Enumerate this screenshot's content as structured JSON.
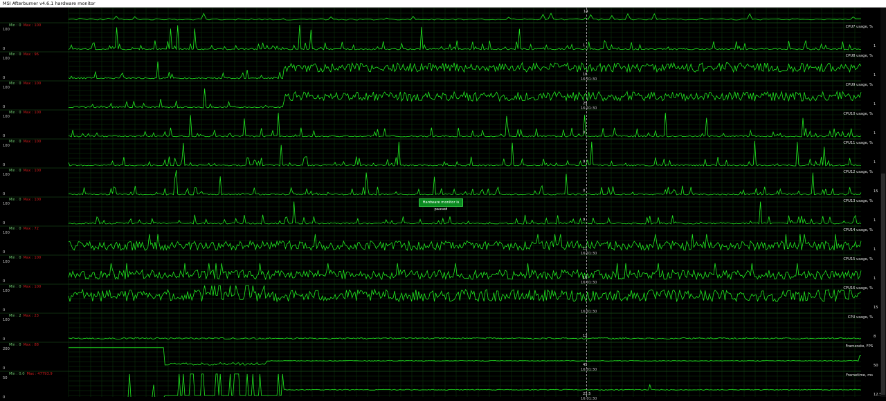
{
  "window": {
    "title": "MSI Afterburner v4.6.1 hardware monitor",
    "icon": "afterburner-icon"
  },
  "paused_message": "Hardware monitor is paused",
  "cursor_time": "16:01:30",
  "colors": {
    "background": "#000000",
    "grid": "#0f3d0f",
    "trace": "#22ee22",
    "min_text": "#6ec86e",
    "max_text": "#d21e1e",
    "banner": "#0a8a20"
  },
  "top_partial_graph": {
    "current_value": "14"
  },
  "graphs": [
    {
      "name": "CPU7 usage, %",
      "min": "Min : 0",
      "max": "Max : 100",
      "axis_top": "100",
      "axis_bottom": "0",
      "current_value": "1",
      "cursor_value": "1",
      "timestamp": ""
    },
    {
      "name": "CPU8 usage, %",
      "min": "Min : 0",
      "max": "Max : 96",
      "axis_top": "100",
      "axis_bottom": "0",
      "current_value": "1",
      "cursor_value": "16",
      "timestamp": "16:01:30"
    },
    {
      "name": "CPU9 usage, %",
      "min": "Min : 0",
      "max": "Max : 100",
      "axis_top": "100",
      "axis_bottom": "0",
      "current_value": "1",
      "cursor_value": "25",
      "timestamp": "16:01:30"
    },
    {
      "name": "CPU10 usage, %",
      "min": "Min : 0",
      "max": "Max : 100",
      "axis_top": "100",
      "axis_bottom": "0",
      "current_value": "1",
      "cursor_value": "0",
      "timestamp": ""
    },
    {
      "name": "CPU11 usage, %",
      "min": "Min : 0",
      "max": "Max : 100",
      "axis_top": "100",
      "axis_bottom": "0",
      "current_value": "1",
      "cursor_value": "9",
      "timestamp": ""
    },
    {
      "name": "CPU12 usage, %",
      "min": "Min : 0",
      "max": "Max : 100",
      "axis_top": "100",
      "axis_bottom": "0",
      "current_value": "15",
      "cursor_value": "0",
      "timestamp": ""
    },
    {
      "name": "CPU13 usage, %",
      "min": "Min : 0",
      "max": "Max : 100",
      "axis_top": "100",
      "axis_bottom": "0",
      "current_value": "1",
      "cursor_value": "9",
      "timestamp": ""
    },
    {
      "name": "CPU14 usage, %",
      "min": "Min : 0",
      "max": "Max : 72",
      "axis_top": "100",
      "axis_bottom": "0",
      "current_value": "1",
      "cursor_value": "12",
      "timestamp": "16:01:30"
    },
    {
      "name": "CPU15 usage, %",
      "min": "Min : 0",
      "max": "Max : 100",
      "axis_top": "100",
      "axis_bottom": "0",
      "current_value": "1",
      "cursor_value": "16",
      "timestamp": "16:01:30"
    },
    {
      "name": "CPU16 usage, %",
      "min": "Min : 0",
      "max": "Max : 100",
      "axis_top": "100",
      "axis_bottom": "0",
      "current_value": "15",
      "cursor_value": "",
      "timestamp": "16:01:30"
    },
    {
      "name": "CPU usage, %",
      "min": "Min : 2",
      "max": "Max : 23",
      "axis_top": "100",
      "axis_bottom": "0",
      "current_value": "8",
      "cursor_value": "13",
      "timestamp": ""
    },
    {
      "name": "Framerate, FPS",
      "min": "Min : 0",
      "max": "Max : 88",
      "axis_top": "200",
      "axis_bottom": "0",
      "current_value": "50",
      "cursor_value": "45",
      "timestamp": "16:01:30"
    },
    {
      "name": "Frametime, ms",
      "min": "Min : 0.0",
      "max": "Max : 47793.9",
      "axis_top": "50",
      "axis_bottom": "0",
      "current_value": "12.5",
      "cursor_value": "23.5",
      "timestamp": "16:01:30"
    }
  ]
}
